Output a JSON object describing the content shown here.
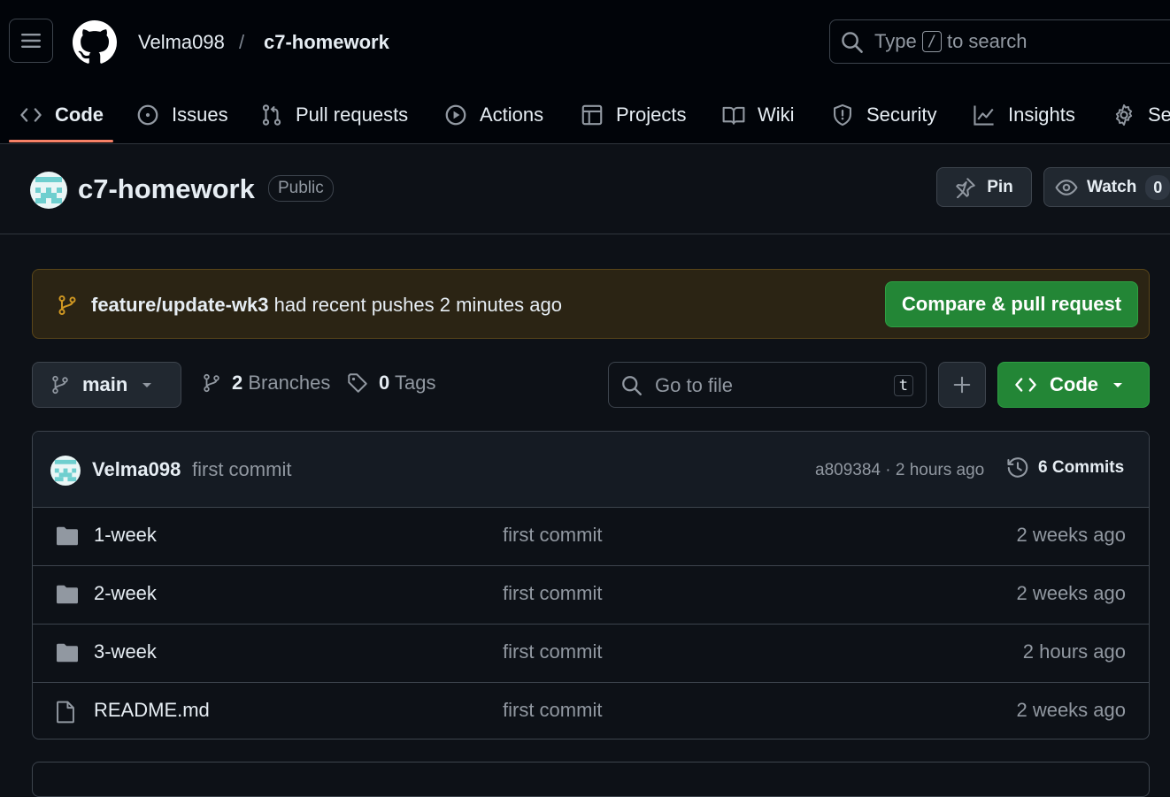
{
  "header": {
    "owner": "Velma098",
    "separator": "/",
    "repo": "c7-homework",
    "search": {
      "prefix": "Type",
      "key": "/",
      "suffix": "to search"
    }
  },
  "nav": {
    "tabs": [
      {
        "label": "Code",
        "icon": "code-icon",
        "active": true
      },
      {
        "label": "Issues",
        "icon": "issue-icon"
      },
      {
        "label": "Pull requests",
        "icon": "pull-request-icon"
      },
      {
        "label": "Actions",
        "icon": "play-icon"
      },
      {
        "label": "Projects",
        "icon": "table-icon"
      },
      {
        "label": "Wiki",
        "icon": "book-icon"
      },
      {
        "label": "Security",
        "icon": "shield-icon"
      },
      {
        "label": "Insights",
        "icon": "graph-icon"
      },
      {
        "label": "Settings",
        "icon": "gear-icon"
      }
    ]
  },
  "repo": {
    "name": "c7-homework",
    "visibility": "Public",
    "pin_label": "Pin",
    "watch_label": "Watch",
    "watch_count": "0"
  },
  "banner": {
    "branch": "feature/update-wk3",
    "text": "had recent pushes 2 minutes ago",
    "button": "Compare & pull request"
  },
  "toolbar": {
    "branch": "main",
    "branches_count": "2",
    "branches_label": "Branches",
    "tags_count": "0",
    "tags_label": "Tags",
    "gotofile_placeholder": "Go to file",
    "gotofile_key": "t",
    "code_button": "Code"
  },
  "commit": {
    "author": "Velma098",
    "message": "first commit",
    "meta": "a809384 · 2 hours ago",
    "count_label": "6 Commits"
  },
  "files": [
    {
      "type": "folder",
      "name": "1-week",
      "message": "first commit",
      "time": "2 weeks ago"
    },
    {
      "type": "folder",
      "name": "2-week",
      "message": "first commit",
      "time": "2 weeks ago"
    },
    {
      "type": "folder",
      "name": "3-week",
      "message": "first commit",
      "time": "2 hours ago"
    },
    {
      "type": "file",
      "name": "README.md",
      "message": "first commit",
      "time": "2 weeks ago"
    }
  ],
  "colors": {
    "background": "#0d1117",
    "header_bg": "#010409",
    "accent_green": "#238636",
    "active_tab_underline": "#f78166",
    "banner_bg": "#2b2414",
    "banner_icon": "#d29922"
  }
}
